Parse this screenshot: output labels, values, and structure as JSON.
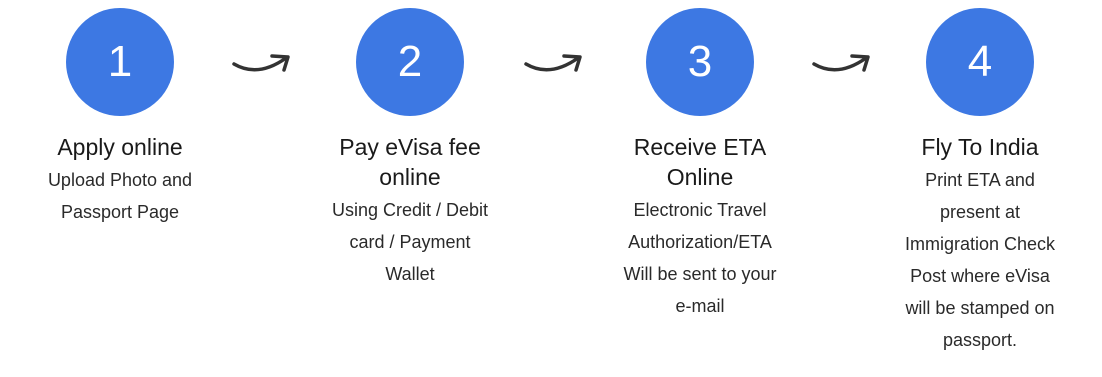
{
  "accent_color": "#3d78e3",
  "steps": [
    {
      "number": "1",
      "title_lines": [
        "Apply online"
      ],
      "desc_lines": [
        "Upload Photo and",
        "Passport Page"
      ]
    },
    {
      "number": "2",
      "title_lines": [
        "Pay eVisa fee",
        "online"
      ],
      "desc_lines": [
        "Using Credit / Debit",
        "card / Payment",
        "Wallet"
      ]
    },
    {
      "number": "3",
      "title_lines": [
        "Receive ETA",
        "Online"
      ],
      "desc_lines": [
        "Electronic Travel",
        "Authorization/ETA",
        "Will be sent to your",
        "e-mail"
      ]
    },
    {
      "number": "4",
      "title_lines": [
        "Fly To India"
      ],
      "desc_lines": [
        "Print ETA and",
        "present at",
        "Immigration Check",
        "Post where eVisa",
        "will be stamped on",
        "passport."
      ]
    }
  ],
  "connector_icon": "curved-arrow-icon"
}
